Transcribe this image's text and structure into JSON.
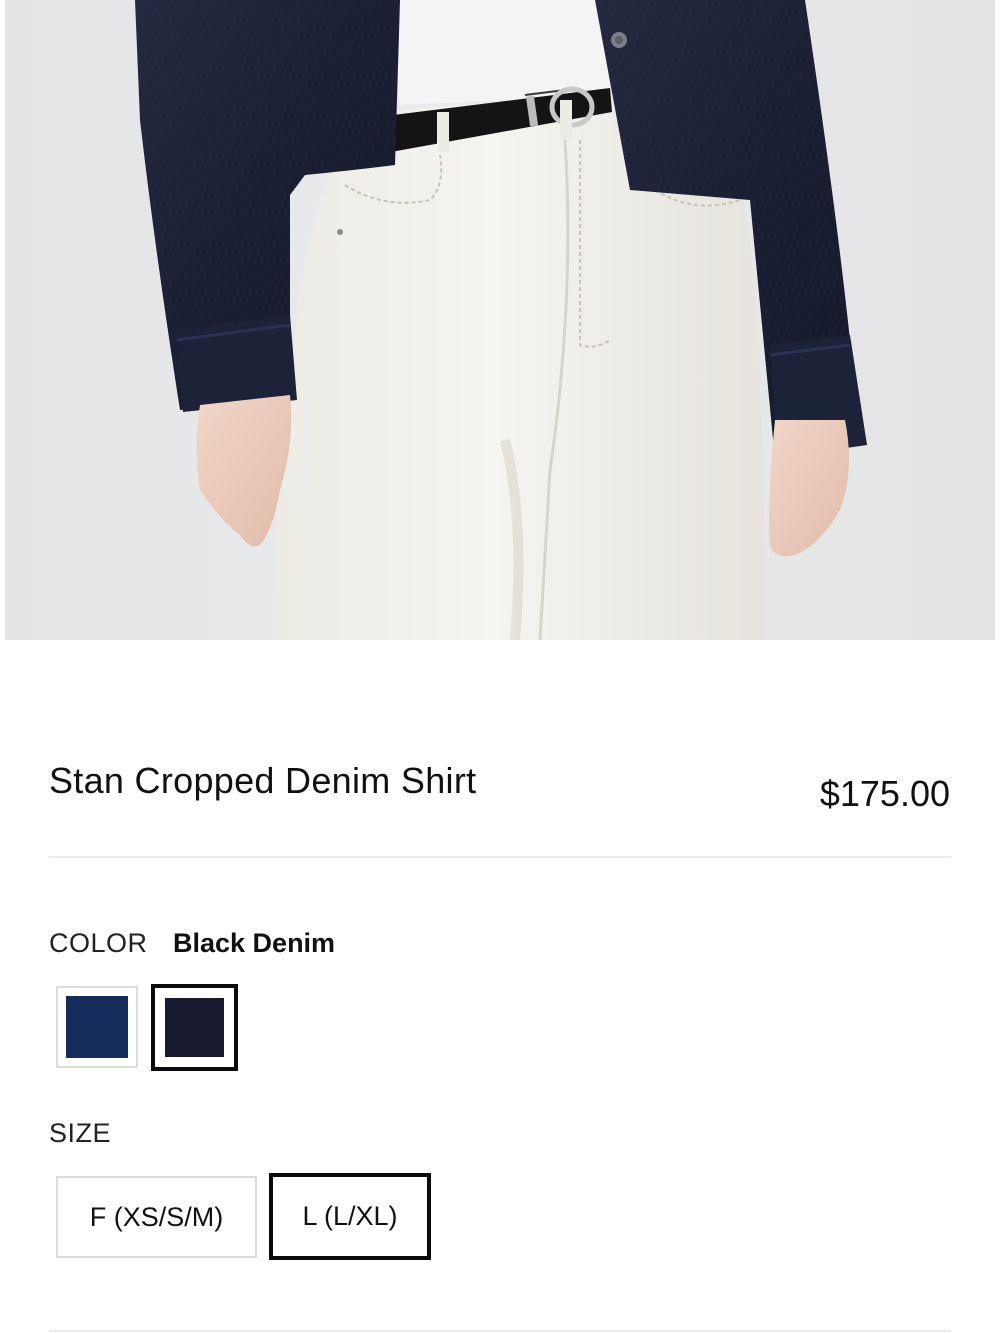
{
  "product": {
    "image_alt": "Model wearing Stan Cropped Denim Shirt with white jeans and black belt",
    "title": "Stan Cropped Denim Shirt",
    "price": "$175.00"
  },
  "color": {
    "label": "COLOR",
    "selected_name": "Black Denim",
    "options": [
      {
        "name": "Navy Denim",
        "hex": "#142d5c",
        "selected": false
      },
      {
        "name": "Black Denim",
        "hex": "#171a30",
        "selected": true
      }
    ]
  },
  "size": {
    "label": "SIZE",
    "options": [
      {
        "label": "F (XS/S/M)",
        "selected": false
      },
      {
        "label": "L (L/XL)",
        "selected": true
      }
    ]
  },
  "colors": {
    "text": "#111111",
    "divider": "#ebebe8",
    "photo_background": "#e6e7e9",
    "selected_border": "#0b0b0b",
    "unselected_border": "#dcdcdc"
  }
}
